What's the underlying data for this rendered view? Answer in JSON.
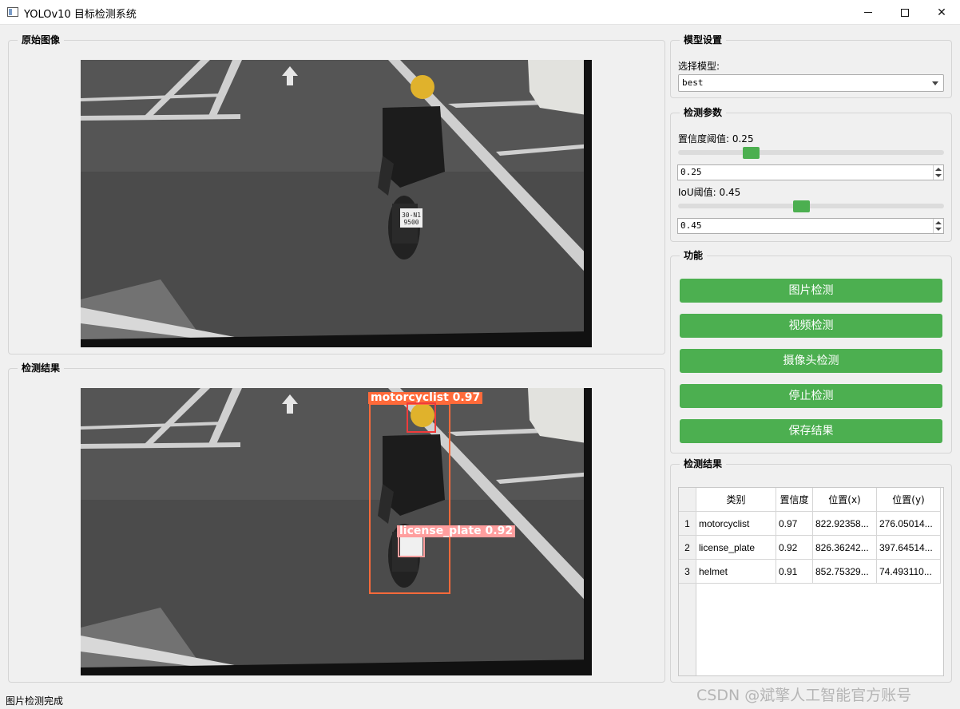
{
  "window": {
    "title": "YOLOv10 目标检测系统",
    "minimize": "—",
    "maximize": "☐",
    "close": "✕"
  },
  "original": {
    "title": "原始图像"
  },
  "result_image": {
    "title": "检测结果",
    "detections": [
      {
        "label": "motorcyclist  0.97",
        "color": "#ff6a3a"
      },
      {
        "label": "license_plate  0.92",
        "color": "#ff9e9e"
      },
      {
        "label": "",
        "color": "#f03b3b"
      }
    ]
  },
  "model_settings": {
    "title": "模型设置",
    "select_label": "选择模型:",
    "selected_model": "best"
  },
  "params": {
    "title": "检测参数",
    "conf_label": "置信度阈值: 0.25",
    "conf_value": "0.25",
    "conf_fraction": 0.25,
    "iou_label": "IoU阈值: 0.45",
    "iou_value": "0.45",
    "iou_fraction": 0.45
  },
  "functions": {
    "title": "功能",
    "buttons": [
      "图片检测",
      "视频检测",
      "摄像头检测",
      "停止检测",
      "保存结果"
    ],
    "accent": "#4caf50"
  },
  "results_table": {
    "title": "检测结果",
    "headers": [
      "类别",
      "置信度",
      "位置(x)",
      "位置(y)"
    ],
    "rows": [
      {
        "num": "1",
        "cls": "motorcyclist",
        "conf": "0.97",
        "x": "822.92358...",
        "y": "276.05014..."
      },
      {
        "num": "2",
        "cls": "license_plate",
        "conf": "0.92",
        "x": "826.36242...",
        "y": "397.64514..."
      },
      {
        "num": "3",
        "cls": "helmet",
        "conf": "0.91",
        "x": "852.75329...",
        "y": "74.493110..."
      }
    ]
  },
  "status": "图片检测完成",
  "watermark": "CSDN @斌擎人工智能官方账号",
  "plate_text": [
    "30-N1",
    "9500"
  ]
}
